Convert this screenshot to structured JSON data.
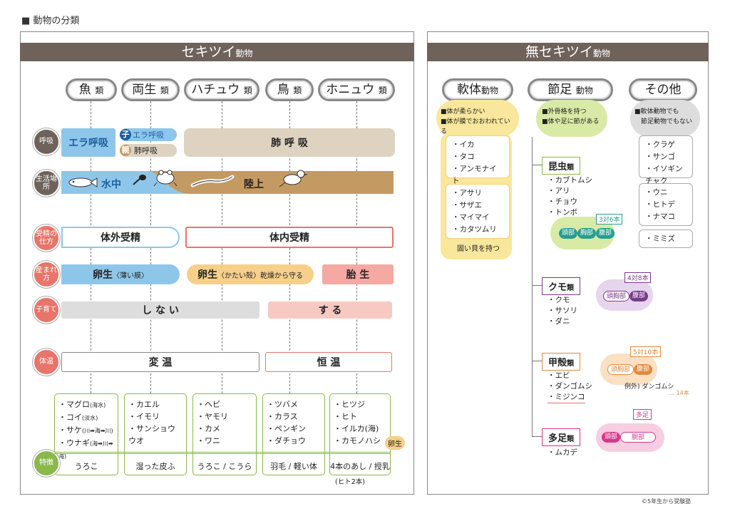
{
  "page_title": "■ 動物の分類",
  "copyright": "©5年生から受験塾",
  "vert": {
    "header": "セキツイ",
    "header_suffix": "動物",
    "classes": [
      {
        "main": "魚",
        "suffix": "類"
      },
      {
        "main": "両生",
        "suffix": "類"
      },
      {
        "main": "ハチュウ",
        "suffix": "類"
      },
      {
        "main": "鳥",
        "suffix": "類"
      },
      {
        "main": "ホニュウ",
        "suffix": "類"
      }
    ],
    "rows": {
      "breathing": "呼吸",
      "habitat": "生活場所",
      "fert": "受精の仕方",
      "birth": "産まれ方",
      "parenting": "子育て",
      "temp": "体温",
      "features": "特徴"
    },
    "breath": {
      "gill": "エラ呼吸",
      "child_mark": "子",
      "child": "エラ呼吸",
      "parent_mark": "親",
      "parent": "肺呼吸",
      "lung": "肺 呼 吸"
    },
    "habitat": {
      "water": "水中",
      "land": "陸上"
    },
    "fert": {
      "external": "体外受精",
      "internal": "体内受精"
    },
    "birth": {
      "egg_soft": "卵生",
      "egg_soft_note": "〈薄い膜〉",
      "egg_hard": "卵生",
      "egg_hard_note": "〈かたい殻〉乾燥から守る",
      "live": "胎 生"
    },
    "parenting": {
      "no": "し な い",
      "yes": "す る"
    },
    "temp": {
      "variable": "変 温",
      "constant": "恒 温"
    },
    "examples": [
      {
        "items": [
          {
            "name": "・マグロ",
            "note": "(海水)"
          },
          {
            "name": "・コイ",
            "note": "(淡水)"
          },
          {
            "name": "・サケ",
            "note": "(川➡海➡川)"
          },
          {
            "name": "・ウナギ",
            "note": "(海➡川➡海)"
          }
        ],
        "feature": "うろこ"
      },
      {
        "items": [
          {
            "name": "・カエル",
            "note": ""
          },
          {
            "name": "・イモリ",
            "note": ""
          },
          {
            "name": "・サンショウウオ",
            "note": ""
          }
        ],
        "feature": "湿った皮ふ"
      },
      {
        "items": [
          {
            "name": "・ヘビ",
            "note": ""
          },
          {
            "name": "・ヤモリ",
            "note": ""
          },
          {
            "name": "・カメ",
            "note": ""
          },
          {
            "name": "・ワニ",
            "note": ""
          }
        ],
        "feature": "うろこ / こうら"
      },
      {
        "items": [
          {
            "name": "・ツバメ",
            "note": ""
          },
          {
            "name": "・カラス",
            "note": ""
          },
          {
            "name": "・ペンギン",
            "note": ""
          },
          {
            "name": "・ダチョウ",
            "note": ""
          }
        ],
        "feature": "羽毛 / 軽い体"
      },
      {
        "items": [
          {
            "name": "・ヒツジ",
            "note": ""
          },
          {
            "name": "・ヒト",
            "note": ""
          },
          {
            "name": "・イルカ(海)",
            "note": ""
          },
          {
            "name": "・カモノハシ",
            "note": ""
          }
        ],
        "feature": "4本のあし / 授乳"
      }
    ],
    "egg_badge": "卵生",
    "human_note": "(ヒト2本)"
  },
  "invert": {
    "header": "無セキツイ",
    "header_suffix": "動物",
    "groups": [
      {
        "main": "軟体",
        "suffix": "動物"
      },
      {
        "main": "節足",
        "suffix": "動物"
      },
      {
        "main": "その他",
        "suffix": ""
      }
    ],
    "mollusk": {
      "desc": [
        "■体が柔らかい",
        "■体が膜でおおわれている"
      ],
      "list1": [
        "・イカ",
        "・タコ",
        "・アンモナイト"
      ],
      "list2": [
        "・アサリ",
        "・サザエ",
        "・マイマイ",
        "・カタツムリ"
      ],
      "shell": "固い貝を持つ"
    },
    "arthropod": {
      "desc": [
        "■外骨格を持つ",
        "■体や足に節がある"
      ],
      "insect": {
        "main": "昆虫",
        "suffix": "類",
        "items": [
          "・カブトムシ",
          "・アリ",
          "・チョウ",
          "・トンボ"
        ],
        "legs": "3対6本",
        "parts": [
          "頭部",
          "胸部",
          "腹部"
        ]
      },
      "spider": {
        "main": "クモ",
        "suffix": "類",
        "items": [
          "・クモ",
          "・サソリ",
          "・ダニ"
        ],
        "legs": "4対8本",
        "parts": [
          "頭胸部",
          "腹部"
        ]
      },
      "crust": {
        "main": "甲殻",
        "suffix": "類",
        "items": [
          "・エビ",
          "・ダンゴムシ",
          "・ミジンコ"
        ],
        "legs": "5対10本",
        "parts": [
          "頭胸部",
          "腹部"
        ],
        "exception": "例外) ダンゴムシ",
        "exception_legs": "… 14本"
      },
      "myria": {
        "main": "多足",
        "suffix": "類",
        "items": [
          "・ムカデ"
        ],
        "legs": "多足",
        "parts": [
          "頭部",
          "胴部"
        ]
      }
    },
    "other": {
      "desc": [
        "■軟体動物でも",
        "　節足動物でもない"
      ],
      "list1": [
        "・クラゲ",
        "・サンゴ",
        "・イソギンチャク"
      ],
      "list2": [
        "・ウニ",
        "・ヒトデ",
        "・ナマコ"
      ],
      "list3": [
        "・ミミズ"
      ]
    }
  },
  "colors": {
    "header": "#6e625b",
    "blue": "#8ec6ea",
    "beige": "#ddd3c0",
    "brown": "#c49a63",
    "pink": "#f4aaa3",
    "orange": "#f6cf8a",
    "red": "#e8746a",
    "green": "#8ab84a",
    "yellow": "#f8e79c"
  }
}
